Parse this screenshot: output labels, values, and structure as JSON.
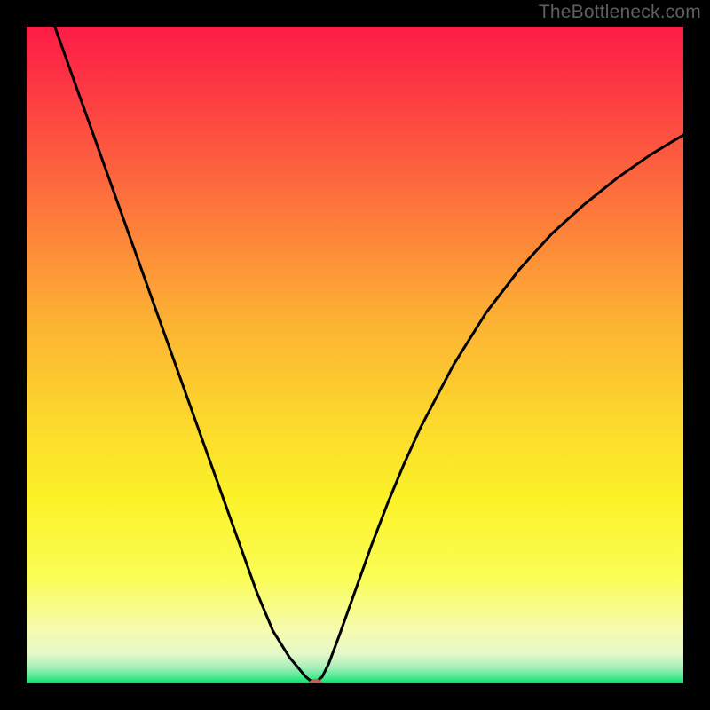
{
  "attribution": "TheBottleneck.com",
  "colors": {
    "background": "#000000",
    "gradient_top": "#fd1c46",
    "gradient_mid_upper": "#fd6d3d",
    "gradient_mid": "#fcc92f",
    "gradient_mid_lower": "#fbf228",
    "gradient_lower": "#f6fbb0",
    "gradient_bottom": "#00e46b",
    "curve": "#000000",
    "marker_fill": "#c06058",
    "attribution_text": "#5f5f5f"
  },
  "chart_data": {
    "type": "line",
    "title": "",
    "xlabel": "",
    "ylabel": "",
    "xlim": [
      0,
      100
    ],
    "ylim": [
      0,
      100
    ],
    "series": [
      {
        "name": "bottleneck-curve",
        "x": [
          0,
          2.5,
          5,
          7.5,
          10,
          12.5,
          15,
          17.5,
          20,
          22.5,
          25,
          27.5,
          30,
          32.5,
          35,
          37.5,
          40,
          42.5,
          43.75,
          45,
          46,
          47.5,
          50,
          52.5,
          55,
          57.5,
          60,
          65,
          70,
          75,
          80,
          85,
          90,
          95,
          100
        ],
        "y": [
          112,
          105,
          98,
          91,
          84,
          77,
          70,
          63,
          56,
          49,
          42,
          35,
          28,
          21,
          14,
          8,
          4,
          1,
          0,
          1,
          3,
          7,
          14,
          21,
          27.5,
          33.5,
          39,
          48.5,
          56.5,
          63,
          68.5,
          73,
          77,
          80.5,
          83.5
        ]
      }
    ],
    "markers": [
      {
        "name": "optimal-point",
        "x": 44,
        "y": 0,
        "rx": 1.0,
        "ry": 0.7
      }
    ],
    "gradient_stops": [
      {
        "offset": 0.0,
        "color": "#fd1c46"
      },
      {
        "offset": 0.1,
        "color": "#fd3a43"
      },
      {
        "offset": 0.25,
        "color": "#fd6d3d"
      },
      {
        "offset": 0.45,
        "color": "#fdb233"
      },
      {
        "offset": 0.6,
        "color": "#fcd82c"
      },
      {
        "offset": 0.72,
        "color": "#fbf228"
      },
      {
        "offset": 0.84,
        "color": "#fafd56"
      },
      {
        "offset": 0.92,
        "color": "#f6fbb0"
      },
      {
        "offset": 0.955,
        "color": "#e5f8c8"
      },
      {
        "offset": 0.975,
        "color": "#a9efbb"
      },
      {
        "offset": 0.99,
        "color": "#4fe993"
      },
      {
        "offset": 1.0,
        "color": "#00e46b"
      }
    ]
  }
}
